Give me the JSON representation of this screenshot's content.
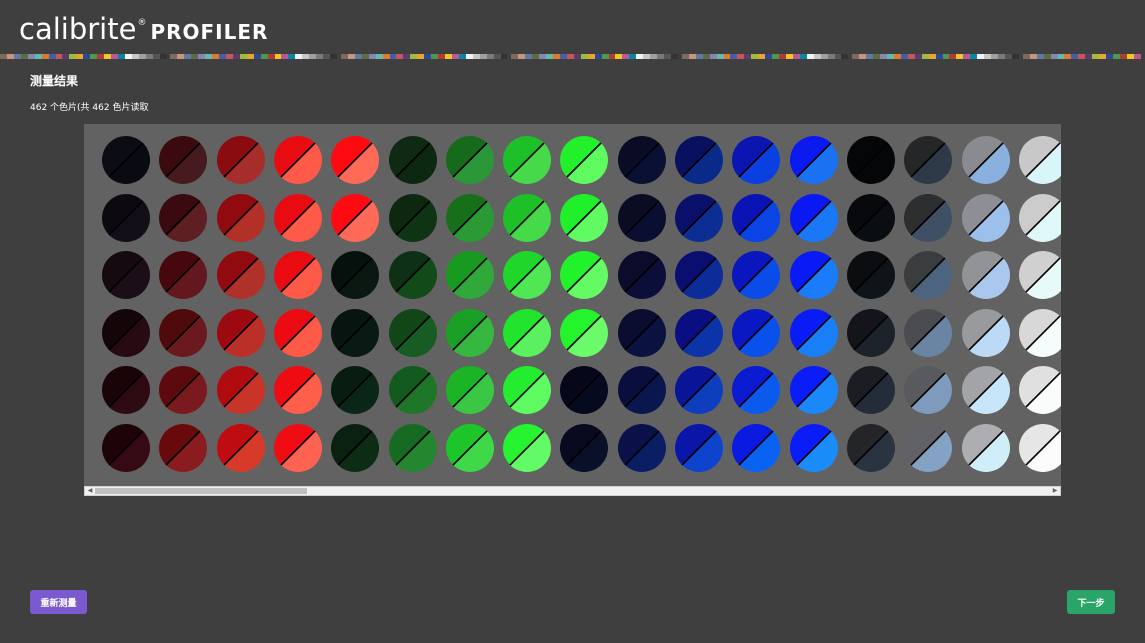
{
  "app": {
    "logo_main": "calibrite",
    "logo_reg": "®",
    "logo_sub": "PROFILER"
  },
  "strip_colors": [
    "#7e6a5b",
    "#c9967d",
    "#5d7aa0",
    "#5b6c43",
    "#8587b1",
    "#63bcab",
    "#dc7a30",
    "#465ea6",
    "#c6565e",
    "#5a3c6b",
    "#9cbc3e",
    "#e5a72e",
    "#31459a",
    "#4a9a4c",
    "#b03a34",
    "#eec726",
    "#bb5795",
    "#0a85a2",
    "#f3f3f3",
    "#c8c8c8",
    "#a0a0a0",
    "#7a7a7a",
    "#555555",
    "#333333"
  ],
  "page": {
    "title": "测量结果",
    "patch_count": "462 个色片(共 462 色片读取"
  },
  "patch_grid": [
    [
      [
        "#0b0c14",
        "#0a0b12"
      ],
      [
        "#3a0a0e",
        "#461a1e"
      ],
      [
        "#8a0c10",
        "#a52e2a"
      ],
      [
        "#e80c12",
        "#ff5a48"
      ],
      [
        "#ff0a10",
        "#ff6a58"
      ],
      [
        "#0f2a12",
        "#0c2810"
      ],
      [
        "#166a1c",
        "#2a9838"
      ],
      [
        "#1ec02a",
        "#46da4a"
      ],
      [
        "#22f02a",
        "#5efa60"
      ],
      [
        "#0a0c26",
        "#0a1034"
      ],
      [
        "#0a1060",
        "#0a2a8a"
      ],
      [
        "#0b16b0",
        "#0a40e0"
      ],
      [
        "#0a1af0",
        "#1a72f2"
      ],
      [
        "#050608",
        "#050607"
      ],
      [
        "#252628",
        "#2f3a48"
      ],
      [
        "#8a8b90",
        "#8ab0e0"
      ],
      [
        "#c8c8c8",
        "#d8f6fa"
      ]
    ],
    [
      [
        "#0c0a10",
        "#140e18"
      ],
      [
        "#3a0a10",
        "#5e1e22"
      ],
      [
        "#900a10",
        "#b23028"
      ],
      [
        "#e80c12",
        "#ff5a48"
      ],
      [
        "#ff0a12",
        "#ff6a58"
      ],
      [
        "#0e2810",
        "#0e3414"
      ],
      [
        "#177019",
        "#2a9a34"
      ],
      [
        "#1ec028",
        "#46da48"
      ],
      [
        "#20f02a",
        "#60fa62"
      ],
      [
        "#0a0c24",
        "#0a0e30"
      ],
      [
        "#0a106a",
        "#0c2e94"
      ],
      [
        "#0a14b4",
        "#0a44e4"
      ],
      [
        "#0a18f2",
        "#1a78f6"
      ],
      [
        "#07090c",
        "#0a0d12"
      ],
      [
        "#2c2e30",
        "#3f5064"
      ],
      [
        "#8e8f94",
        "#9cc0ea"
      ],
      [
        "#cccccc",
        "#def8fa"
      ]
    ],
    [
      [
        "#140a10",
        "#1c0e18"
      ],
      [
        "#46080c",
        "#62181e"
      ],
      [
        "#900a10",
        "#b0302a"
      ],
      [
        "#e80c12",
        "#ff5a48"
      ],
      [
        "#06100c",
        "#0a1812"
      ],
      [
        "#0e3014",
        "#134a1a"
      ],
      [
        "#189a20",
        "#30a83a"
      ],
      [
        "#20d62a",
        "#50e654"
      ],
      [
        "#22f22a",
        "#64fa64"
      ],
      [
        "#0a0c2a",
        "#0a0e38"
      ],
      [
        "#0a0e70",
        "#0c2c9a"
      ],
      [
        "#0a16be",
        "#0a4ce8"
      ],
      [
        "#0a1af4",
        "#1a7cf8"
      ],
      [
        "#0b0d10",
        "#0f1418"
      ],
      [
        "#3a3c3e",
        "#4c6480"
      ],
      [
        "#929396",
        "#aac8ee"
      ],
      [
        "#d0d0d0",
        "#e6fafa"
      ]
    ],
    [
      [
        "#140608",
        "#280a12"
      ],
      [
        "#500a0c",
        "#6a1a1e"
      ],
      [
        "#9c0a10",
        "#ba3028"
      ],
      [
        "#ea0c12",
        "#ff5a48"
      ],
      [
        "#071410",
        "#091a14"
      ],
      [
        "#104618",
        "#175c22"
      ],
      [
        "#1aa024",
        "#36b840"
      ],
      [
        "#22e42c",
        "#5af060"
      ],
      [
        "#24f42c",
        "#6afa6a"
      ],
      [
        "#0a0c30",
        "#0a1240"
      ],
      [
        "#0a0e82",
        "#0c34aa"
      ],
      [
        "#0a18c4",
        "#0a50ea"
      ],
      [
        "#0a1cf6",
        "#1a80fa"
      ],
      [
        "#13151a",
        "#1b222a"
      ],
      [
        "#4a4c50",
        "#6a84a4"
      ],
      [
        "#989a9e",
        "#bcdaf6"
      ],
      [
        "#d8d8d8",
        "#f4fcfc"
      ]
    ],
    [
      [
        "#1a0408",
        "#2e0a12"
      ],
      [
        "#5c0a0c",
        "#7a1a1e"
      ],
      [
        "#b00c10",
        "#c83428"
      ],
      [
        "#ee0c12",
        "#ff5e4a"
      ],
      [
        "#081c10",
        "#0a2616"
      ],
      [
        "#135a1e",
        "#1e7628"
      ],
      [
        "#1ab426",
        "#3ac844"
      ],
      [
        "#24ec2e",
        "#5efa62"
      ],
      [
        "#06081a",
        "#060a1e"
      ],
      [
        "#0a0e3c",
        "#0a164e"
      ],
      [
        "#0a1496",
        "#0c3ebe"
      ],
      [
        "#0a1ad0",
        "#0a5aee"
      ],
      [
        "#0a1cf8",
        "#1a88fa"
      ],
      [
        "#1b1d22",
        "#232c38"
      ],
      [
        "#585a5e",
        "#7e9abc"
      ],
      [
        "#a2a4a8",
        "#c8e6fa"
      ],
      [
        "#e0e0e0",
        "#fafcfc"
      ]
    ],
    [
      [
        "#1e0408",
        "#360a14"
      ],
      [
        "#680a0c",
        "#8a1c20"
      ],
      [
        "#be0c10",
        "#d83a2a"
      ],
      [
        "#f00c12",
        "#ff6250"
      ],
      [
        "#0a2010",
        "#0d2c14"
      ],
      [
        "#176a22",
        "#24862e"
      ],
      [
        "#1cc628",
        "#3ed848"
      ],
      [
        "#26f430",
        "#62fa66"
      ],
      [
        "#080a20",
        "#0a1028"
      ],
      [
        "#0a1048",
        "#0a1e64"
      ],
      [
        "#0a16a8",
        "#0c44ce"
      ],
      [
        "#0a1ae0",
        "#0a62f2"
      ],
      [
        "#0a1cf8",
        "#1a8cfa"
      ],
      [
        "#232528",
        "#2a3440"
      ],
      [
        "#606266",
        "#84a2c4"
      ],
      [
        "#acaeb2",
        "#d0eefa"
      ],
      [
        "#e6e6e6",
        "#fcfcfc"
      ]
    ]
  ]
}
